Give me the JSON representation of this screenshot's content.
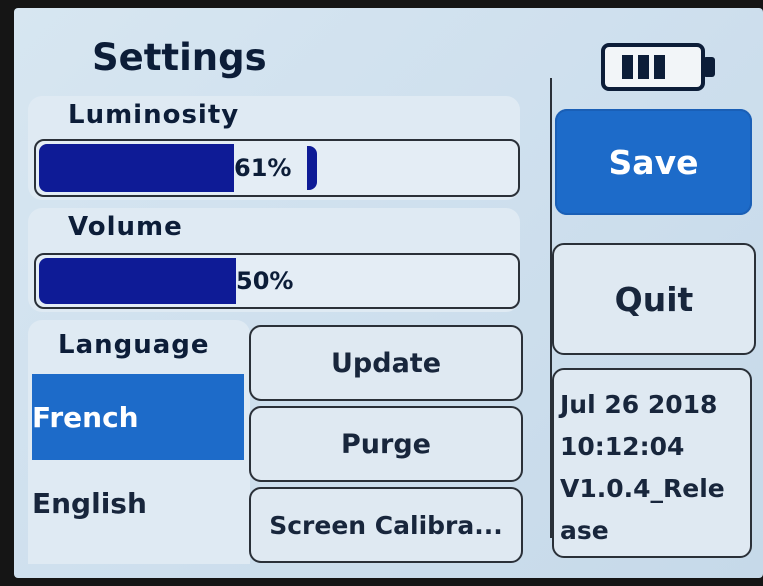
{
  "header": {
    "title": "Settings"
  },
  "battery": {
    "icon": "battery-full-icon",
    "level": 1.0
  },
  "luminosity": {
    "label": "Luminosity",
    "value_text": "61%",
    "value": 0.61
  },
  "volume": {
    "label": "Volume",
    "value_text": "50%",
    "value": 0.5
  },
  "language": {
    "label": "Language",
    "options": [
      "French",
      "English"
    ],
    "selected": "French"
  },
  "buttons": {
    "update": "Update",
    "purge": "Purge",
    "calibrate": "Screen Calibra...",
    "save": "Save",
    "quit": "Quit"
  },
  "info": {
    "line1": "Jul 26 2018",
    "line2": "10:12:04",
    "line3": "V1.0.4_Rele",
    "line4": "ase"
  },
  "colors": {
    "accent": "#1d6bc9",
    "bar_fill": "#0e1b96",
    "background": "#cfe0ee"
  }
}
